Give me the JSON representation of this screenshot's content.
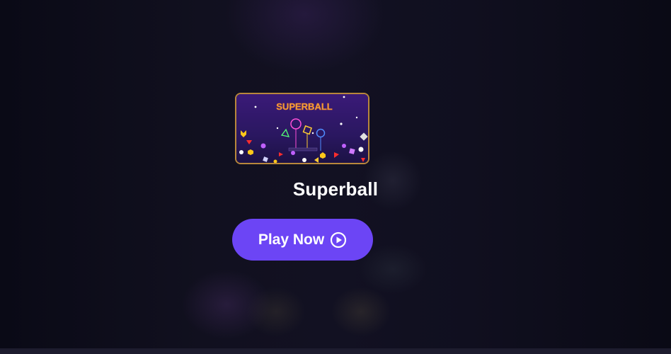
{
  "game": {
    "title": "Superball",
    "thumbnail_logo_text": "SUPERBALL",
    "play_label": "Play Now"
  },
  "colors": {
    "page_background": "#0c0b1a",
    "button": "#6c45f5",
    "thumbnail_border": "#b8873b",
    "text": "#ffffff"
  },
  "icons": {
    "play": "play-circle-icon"
  }
}
